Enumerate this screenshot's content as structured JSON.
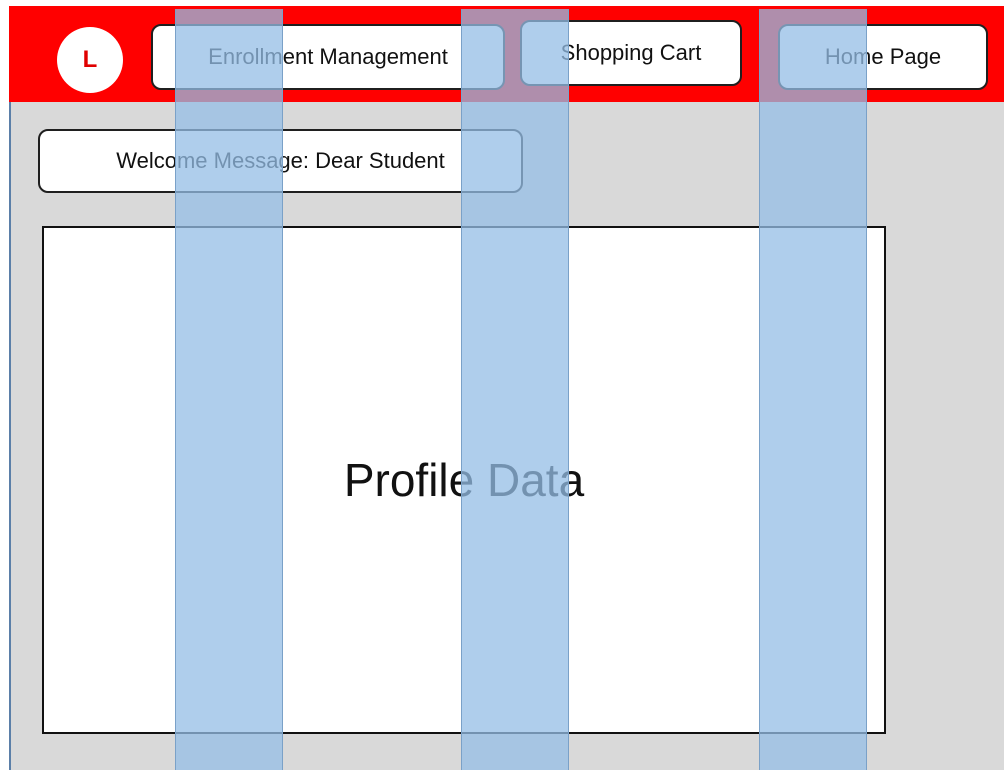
{
  "header": {
    "logo_letter": "L",
    "nav": {
      "enrollment_label": "Enrollment Management",
      "cart_label": "Shopping Cart",
      "home_label": "Home Page"
    }
  },
  "main": {
    "welcome_text": "Welcome Message: Dear Student",
    "profile_text": "Profile Data"
  },
  "colors": {
    "header_bg": "#ff0000",
    "page_bg": "#d9d9d9",
    "logo_text": "#e00000",
    "overlay": "#94bee6"
  }
}
